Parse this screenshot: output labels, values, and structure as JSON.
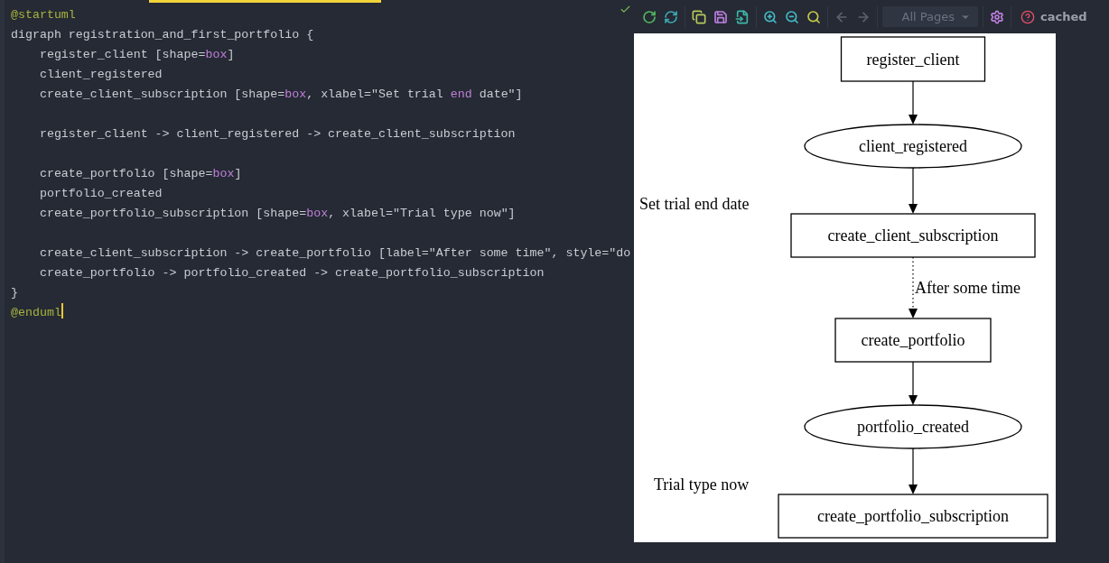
{
  "editor": {
    "blocks": [
      [
        [
          {
            "kind": "directive",
            "text": "@startuml"
          }
        ],
        [
          {
            "kind": "plain",
            "text": "digraph registration_and_first_portfolio {"
          }
        ],
        [
          {
            "kind": "plain",
            "text": "    register_client [shape="
          },
          {
            "kind": "keyword",
            "text": "box"
          },
          {
            "kind": "plain",
            "text": "]"
          }
        ],
        [
          {
            "kind": "plain",
            "text": "    client_registered"
          }
        ],
        [
          {
            "kind": "plain",
            "text": "    create_client_subscription [shape="
          },
          {
            "kind": "keyword",
            "text": "box"
          },
          {
            "kind": "plain",
            "text": ", xlabel=\"Set trial "
          },
          {
            "kind": "keyword",
            "text": "end"
          },
          {
            "kind": "plain",
            "text": " date\"]"
          }
        ]
      ],
      [
        [
          {
            "kind": "plain",
            "text": "    register_client -> client_registered -> create_client_subscription"
          }
        ]
      ],
      [
        [
          {
            "kind": "plain",
            "text": "    create_portfolio [shape="
          },
          {
            "kind": "keyword",
            "text": "box"
          },
          {
            "kind": "plain",
            "text": "]"
          }
        ],
        [
          {
            "kind": "plain",
            "text": "    portfolio_created"
          }
        ],
        [
          {
            "kind": "plain",
            "text": "    create_portfolio_subscription [shape="
          },
          {
            "kind": "keyword",
            "text": "box"
          },
          {
            "kind": "plain",
            "text": ", xlabel=\"Trial type now\"]"
          }
        ]
      ],
      [
        [
          {
            "kind": "plain",
            "text": "    create_client_subscription -> create_portfolio [label=\"After some time\", style=\"do"
          }
        ],
        [
          {
            "kind": "plain",
            "text": "    create_portfolio -> portfolio_created -> create_portfolio_subscription"
          }
        ],
        [
          {
            "kind": "plain",
            "text": "}"
          }
        ],
        [
          {
            "kind": "directive",
            "text": "@enduml"
          }
        ]
      ]
    ],
    "saved": true
  },
  "toolbar": {
    "groups": [
      [
        {
          "kind": "refresh",
          "disabled": false
        },
        {
          "kind": "sync",
          "disabled": false
        }
      ],
      [
        {
          "kind": "copy",
          "disabled": false
        },
        {
          "kind": "save",
          "disabled": false
        },
        {
          "kind": "export",
          "disabled": false
        }
      ],
      [
        {
          "kind": "zoom_in",
          "disabled": false
        },
        {
          "kind": "zoom_out",
          "disabled": false
        },
        {
          "kind": "zoom_reset",
          "disabled": false
        }
      ],
      [
        {
          "kind": "back",
          "disabled": true
        },
        {
          "kind": "forward",
          "disabled": true
        }
      ]
    ],
    "pages_select": {
      "value": "All Pages",
      "disabled": true
    },
    "settings": true,
    "help": true,
    "status": "cached"
  },
  "diagram": {
    "nodes": [
      {
        "kind": "box",
        "label": "register_client"
      },
      {
        "kind": "ellipse",
        "label": "client_registered"
      },
      {
        "kind": "box",
        "label": "create_client_subscription",
        "xlabel": "Set trial end date"
      },
      {
        "kind": "box",
        "label": "create_portfolio"
      },
      {
        "kind": "ellipse",
        "label": "portfolio_created"
      },
      {
        "kind": "box",
        "label": "create_portfolio_subscription",
        "xlabel": "Trial type now"
      }
    ],
    "edges": [
      {
        "dotted": false
      },
      {
        "dotted": false
      },
      {
        "dotted": true,
        "label": "After some time"
      },
      {
        "dotted": false
      },
      {
        "dotted": false
      }
    ]
  }
}
